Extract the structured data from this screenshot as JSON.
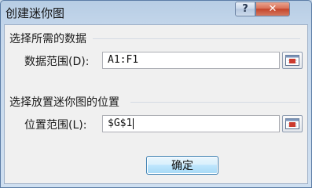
{
  "window": {
    "title": "创建迷你图",
    "help_glyph": "?",
    "close_glyph": "✕"
  },
  "data_section": {
    "heading": "选择所需的数据",
    "field_label": "数据范围(D):",
    "field_value": "A1:F1"
  },
  "location_section": {
    "heading": "选择放置迷你图的位置",
    "field_label": "位置范围(L):",
    "field_value": "$G$1"
  },
  "actions": {
    "ok_label": "确定"
  },
  "icons": {
    "range_picker": "collapse-dialog-icon",
    "accent_color": "#cc3b2f"
  }
}
